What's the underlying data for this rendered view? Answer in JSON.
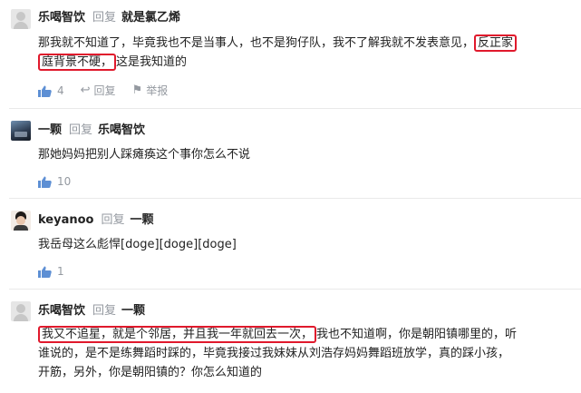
{
  "reply_label": "回复",
  "comments": [
    {
      "author": "乐喝智饮",
      "reply_to": "就是氯乙烯",
      "text_parts": [
        "那我就不知道了，毕竟我也不是当事人，也不是狗仔队，我不了解我就不发表意见，",
        "反正家",
        "庭背景不硬，",
        "这是我知道的"
      ],
      "likes": "4",
      "reply_action": "回复",
      "report_action": "举报"
    },
    {
      "author": "一颗",
      "reply_to": "乐喝智饮",
      "text": "那她妈妈把别人踩瘫痪这个事你怎么不说",
      "likes": "10"
    },
    {
      "author": "keyanoo",
      "reply_to": "一颗",
      "text": "我岳母这么彪悍[doge][doge][doge]",
      "likes": "1"
    },
    {
      "author": "乐喝智饮",
      "reply_to": "一颗",
      "text_parts": [
        "我又不追星，就是个邻居，并且我一年就回去一次，",
        "我也不知道啊，你是朝阳镇哪里的，听",
        "谁说的，是不是练舞蹈时踩的，毕竟我接过我妹妹从刘浩存妈妈舞蹈班放学，真的踩小孩，",
        "开筋，另外，你是朝阳镇的？你怎么知道的"
      ]
    }
  ]
}
